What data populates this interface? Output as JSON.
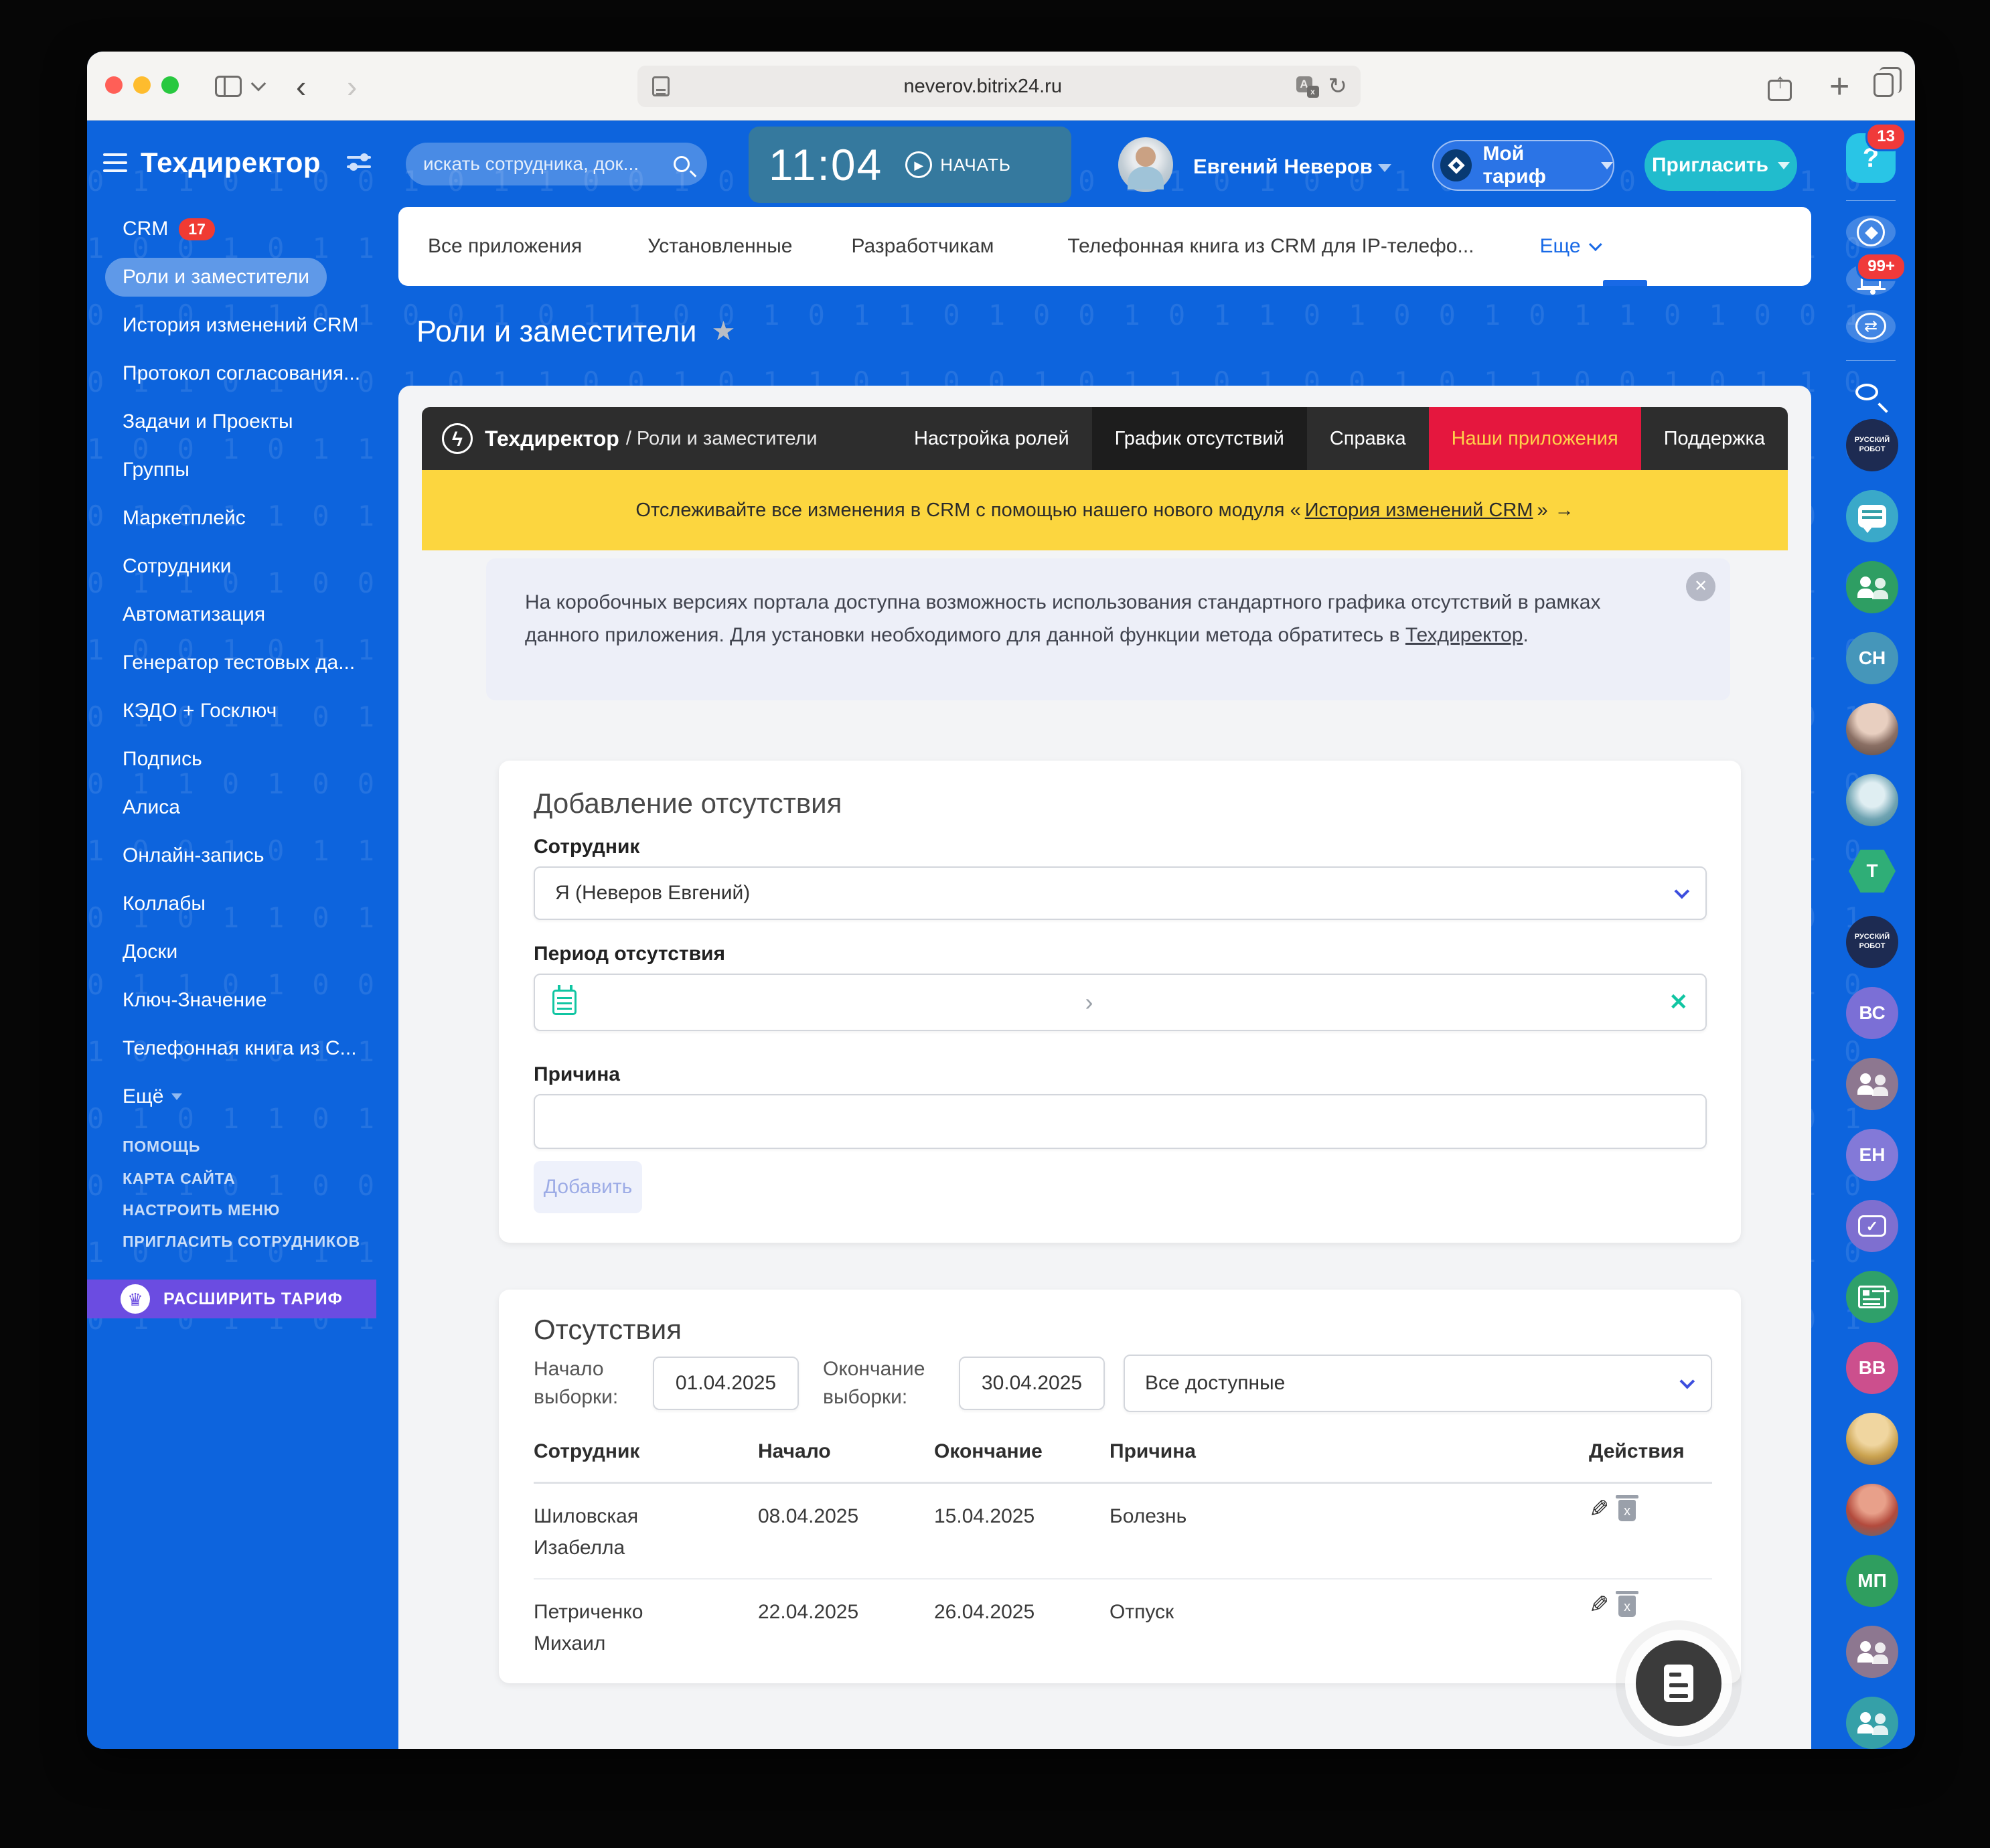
{
  "browser": {
    "url": "neverov.bitrix24.ru"
  },
  "header": {
    "brand": "Техдиректор",
    "search_placeholder": "искать сотрудника, док...",
    "time": "11:04",
    "start_label": "НАЧАТЬ",
    "user_name": "Евгений Неверов",
    "plan_label": "Мой тариф",
    "invite_label": "Пригласить",
    "help_badge": "13"
  },
  "sidebar": {
    "items": [
      {
        "label": "CRM",
        "badge": "17"
      },
      {
        "label": "Роли и заместители",
        "active": true
      },
      {
        "label": "История изменений CRM"
      },
      {
        "label": "Протокол согласования..."
      },
      {
        "label": "Задачи и Проекты"
      },
      {
        "label": "Группы"
      },
      {
        "label": "Маркетплейс"
      },
      {
        "label": "Сотрудники"
      },
      {
        "label": "Автоматизация"
      },
      {
        "label": "Генератор тестовых да..."
      },
      {
        "label": "КЭДО + Госключ"
      },
      {
        "label": "Подпись"
      },
      {
        "label": "Алиса"
      },
      {
        "label": "Онлайн-запись"
      },
      {
        "label": "Коллабы"
      },
      {
        "label": "Доски"
      },
      {
        "label": "Ключ-Значение"
      },
      {
        "label": "Телефонная книга из С..."
      },
      {
        "label": "Ещё"
      }
    ],
    "footer_links": [
      "ПОМОЩЬ",
      "КАРТА САЙТА",
      "НАСТРОИТЬ МЕНЮ",
      "ПРИГЛАСИТЬ СОТРУДНИКОВ"
    ],
    "upgrade_label": "РАСШИРИТЬ ТАРИФ"
  },
  "tabs": {
    "items": [
      "Все приложения",
      "Установленные",
      "Разработчикам",
      "Телефонная книга из CRM для IP-телефо...",
      "Еще"
    ]
  },
  "page": {
    "title": "Роли и заместители"
  },
  "app_nav": {
    "brand": "Техдиректор",
    "breadcrumb": "/ Роли и заместители",
    "items": [
      {
        "label": "Настройка ролей"
      },
      {
        "label": "График отсутствий",
        "state": "active"
      },
      {
        "label": "Справка"
      },
      {
        "label": "Наши приложения",
        "state": "highlight"
      },
      {
        "label": "Поддержка"
      }
    ]
  },
  "banner": {
    "prefix": "Отслеживайте все изменения в CRM с помощью нашего нового модуля «",
    "link": "История изменений CRM",
    "suffix": "»",
    "arrow": "→"
  },
  "notice": {
    "text": "На коробочных версиях портала доступна возможность использования стандартного графика отсутствий в рамках данного приложения. Для установки необходимого для данной функции метода обратитесь в ",
    "link": "Техдиректор",
    "suffix": "."
  },
  "form": {
    "title": "Добавление отсутствия",
    "employee_label": "Сотрудник",
    "employee_value": "Я (Неверов Евгений)",
    "period_label": "Период отсутствия",
    "reason_label": "Причина",
    "reason_value": "",
    "submit_label": "Добавить"
  },
  "absences": {
    "title": "Отсутствия",
    "filter_start_label": "Начало выборки:",
    "filter_start_value": "01.04.2025",
    "filter_end_label": "Окончание выборки:",
    "filter_end_value": "30.04.2025",
    "filter_type_value": "Все доступные",
    "columns": [
      "Сотрудник",
      "Начало",
      "Окончание",
      "Причина",
      "Действия"
    ],
    "rows": [
      {
        "employee": "Шиловская Изабелла",
        "start": "08.04.2025",
        "end": "15.04.2025",
        "reason": "Болезнь"
      },
      {
        "employee": "Петриченко Михаил",
        "start": "22.04.2025",
        "end": "26.04.2025",
        "reason": "Отпуск"
      }
    ]
  },
  "right_rail": {
    "help_glyph": "?",
    "help_badge": "13",
    "bell_badge": "99+",
    "avatars": [
      {
        "kind": "logo",
        "label": "РУССКИЙ РОБОТ"
      },
      {
        "kind": "icon-chat"
      },
      {
        "kind": "icon-people",
        "color": "#2e9e63"
      },
      {
        "kind": "initials",
        "text": "СН",
        "color": "#4596ba"
      },
      {
        "kind": "photo1"
      },
      {
        "kind": "photo2"
      },
      {
        "kind": "hex",
        "text": "Т"
      },
      {
        "kind": "logo",
        "label": "РУССКИЙ РОБОТ"
      },
      {
        "kind": "initials",
        "text": "ВС",
        "color": "#7b6fd6"
      },
      {
        "kind": "icon-people",
        "color": "#8d7790"
      },
      {
        "kind": "initials",
        "text": "ЕН",
        "color": "#8379d8"
      },
      {
        "kind": "icon-task",
        "color": "#7e6fd0"
      },
      {
        "kind": "icon-news",
        "color": "#2fa06a"
      },
      {
        "kind": "initials",
        "text": "ВВ",
        "color": "#cc4f8d"
      },
      {
        "kind": "photo3"
      },
      {
        "kind": "photo4"
      },
      {
        "kind": "initials",
        "text": "МП",
        "color": "#2f9e5f"
      },
      {
        "kind": "icon-people",
        "color": "#8d7790"
      },
      {
        "kind": "icon-people",
        "color": "#35a0a8"
      }
    ]
  },
  "colors": {
    "app_blue": "#0d64dd",
    "clock_teal": "#35799e",
    "invite_teal": "#21bccd",
    "badge_red": "#f03b33",
    "upgrade_purple": "#6b4ce1",
    "nav_dark": "#2d2d2d",
    "nav_highlight_bg": "#e5173e",
    "nav_highlight_text": "#ffd04a",
    "banner_yellow": "#fcd63f",
    "accent_teal": "#10c5a2",
    "chevron_indigo": "#3c4ede",
    "tab_active_blue": "#1869e6"
  },
  "decor": {
    "binary": "011010010110010110100101101001011001011010010110100101101001011010010110010110100101101001011001011010010110100101101001011010010110010110100101101001011001011010010110100101101001011010010110010110100101101001011001011010010110100101101001011010010110010110100101101001011001011010010110100101101001011010010110010110100101101001011001011010010110100101101001011010010110010110100101101001011001011010010110100101101001011010010110010110100101101001011001011010010110100101101001011010010110010110100101101001011001011010010110100101101001011010010110010110100101101001011001011010010110100101101001011010010110010110100101101001011001011010010110100101101001011010010110010110100101101001011001011010010110100101101001"
  }
}
